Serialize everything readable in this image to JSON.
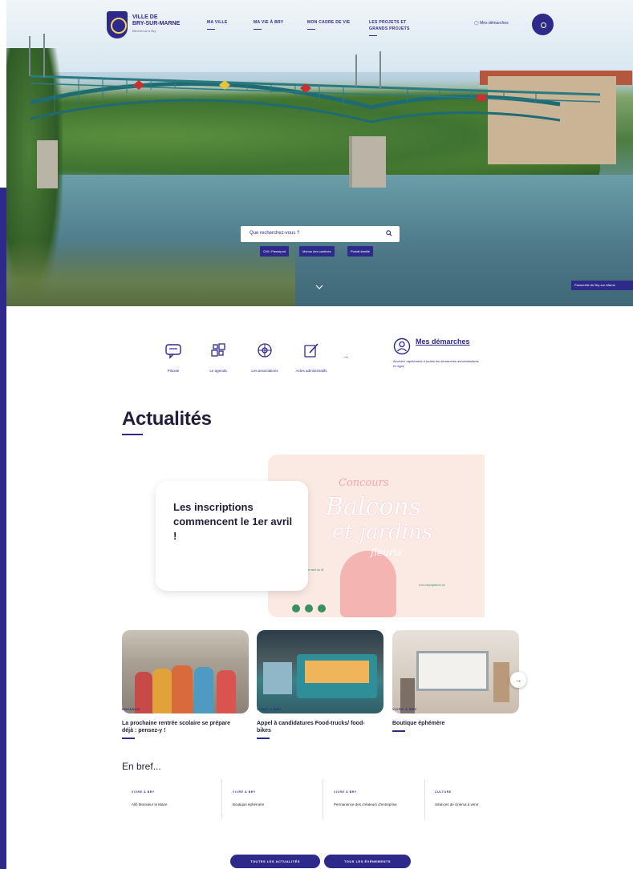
{
  "header": {
    "logo_line1": "VILLE DE",
    "logo_line2": "BRY-SUR-MARNE",
    "logo_tagline": "Bienvenue à Bry",
    "nav": [
      {
        "label": "MA VILLE"
      },
      {
        "label": "MA VIE À BRY"
      },
      {
        "label": "MON CADRE DE VIE"
      },
      {
        "label": "LES PROJETS ET GRANDS PROJETS"
      }
    ],
    "account_label": "Mes démarches"
  },
  "hero": {
    "search_placeholder": "Que recherchez-vous ?",
    "quick_links": [
      "CNI / Passeport",
      "Menus des cantines",
      "Portail famille"
    ],
    "photo_caption": "Passerelle de Bry-sur-Marne"
  },
  "quick_access": {
    "items": [
      {
        "label": "Piloxite",
        "icon": "chat-icon"
      },
      {
        "label": "Le agenda",
        "icon": "grid-icon"
      },
      {
        "label": "Les associations",
        "icon": "network-icon"
      },
      {
        "label": "Actes administratifs",
        "icon": "edit-icon"
      }
    ],
    "arrow": "→",
    "demarches_title": "Mes démarches",
    "demarches_desc": "Accédez rapidement à toutes les démarches administratives en ligne"
  },
  "actualites": {
    "heading": "Actualités",
    "featured": {
      "title": "Les inscriptions commencent le 1er avril !",
      "poster_line1": "Concours",
      "poster_line2": "Balcons",
      "poster_line3": "et jardins",
      "poster_line4": "fleuris",
      "poster_link": "Les inscriptions ici",
      "poster_dates": "Inscriptions du 1er avril au 31 mai"
    },
    "cards": [
      {
        "category": "ENFANCE",
        "title": "La prochaine rentrée scolaire se prépare déjà : pensez-y !"
      },
      {
        "category": "VIVRE À BRY",
        "title": "Appel à candidatures Food-trucks/ food-bikes"
      },
      {
        "category": "VIVRE À BRY",
        "title": "Boutique éphémère"
      }
    ],
    "next_arrow": "→"
  },
  "en_bref": {
    "heading": "En bref...",
    "items": [
      {
        "category": "VIVRE À BRY",
        "text": "Allô Monsieur le Maire"
      },
      {
        "category": "VIVRE À BRY",
        "text": "Boutique éphémère"
      },
      {
        "category": "VIVRE À BRY",
        "text": "Permanence des créateurs d'entreprise"
      },
      {
        "category": "CULTURE",
        "text": "Séances de cinéma à venir"
      }
    ]
  },
  "buttons": {
    "all_news": "TOUTES LES ACTUALITÉS",
    "all_events": "TOUS LES ÉVÉNEMENTS"
  },
  "colors": {
    "brand": "#2d2a8c",
    "text": "#1f1f3a",
    "poster_pink": "#fbe9e4"
  }
}
